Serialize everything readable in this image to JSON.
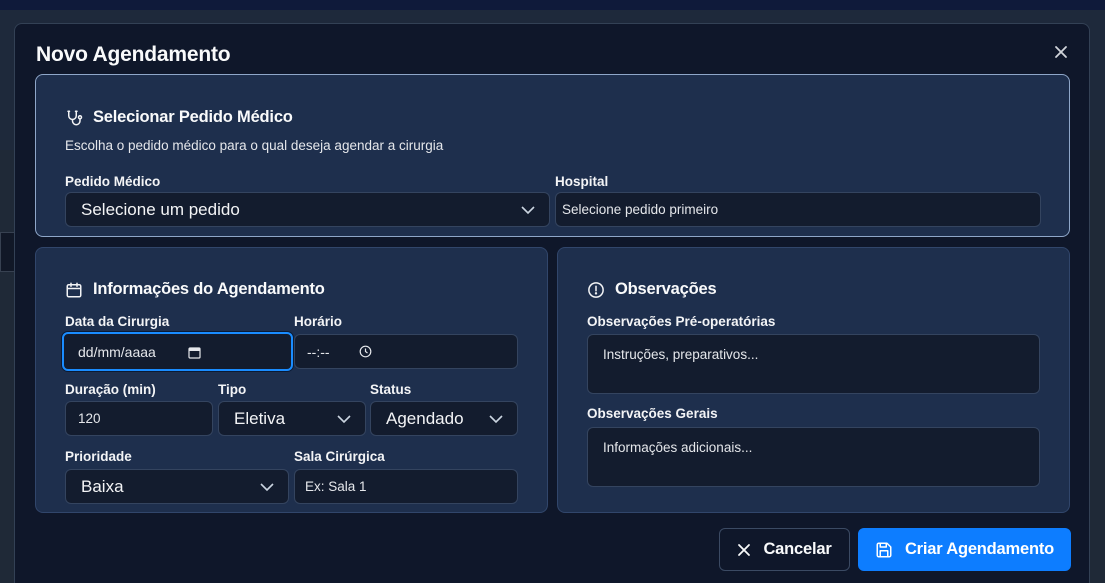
{
  "modal": {
    "title": "Novo Agendamento"
  },
  "pedido_section": {
    "title": "Selecionar Pedido Médico",
    "description": "Escolha o pedido médico para o qual deseja agendar a cirurgia",
    "pedido_label": "Pedido Médico",
    "pedido_value": "Selecione um pedido",
    "hospital_label": "Hospital",
    "hospital_value": "Selecione pedido primeiro"
  },
  "agendamento_section": {
    "title": "Informações do Agendamento",
    "data_label": "Data da Cirurgia",
    "data_value": "dd/mm/aaaa",
    "horario_label": "Horário",
    "horario_value": "--:--",
    "duracao_label": "Duração (min)",
    "duracao_value": "120",
    "tipo_label": "Tipo",
    "tipo_value": "Eletiva",
    "status_label": "Status",
    "status_value": "Agendado",
    "prioridade_label": "Prioridade",
    "prioridade_value": "Baixa",
    "sala_label": "Sala Cirúrgica",
    "sala_placeholder": "Ex: Sala 1"
  },
  "observacoes_section": {
    "title": "Observações",
    "pre_label": "Observações Pré-operatórias",
    "pre_placeholder": "Instruções, preparativos...",
    "gerais_label": "Observações Gerais",
    "gerais_placeholder": "Informações adicionais..."
  },
  "footer": {
    "cancel_label": "Cancelar",
    "submit_label": "Criar Agendamento"
  },
  "colors": {
    "accent": "#0d7dff",
    "focus_ring": "#1a8cff",
    "card_bg": "#1e2f4d",
    "modal_bg": "#0f172a"
  },
  "icons": {
    "close": "close-icon",
    "stethoscope": "stethoscope-icon",
    "calendar": "calendar-icon",
    "alert": "alert-circle-icon",
    "save": "save-icon",
    "chevron": "chevron-down-icon"
  }
}
